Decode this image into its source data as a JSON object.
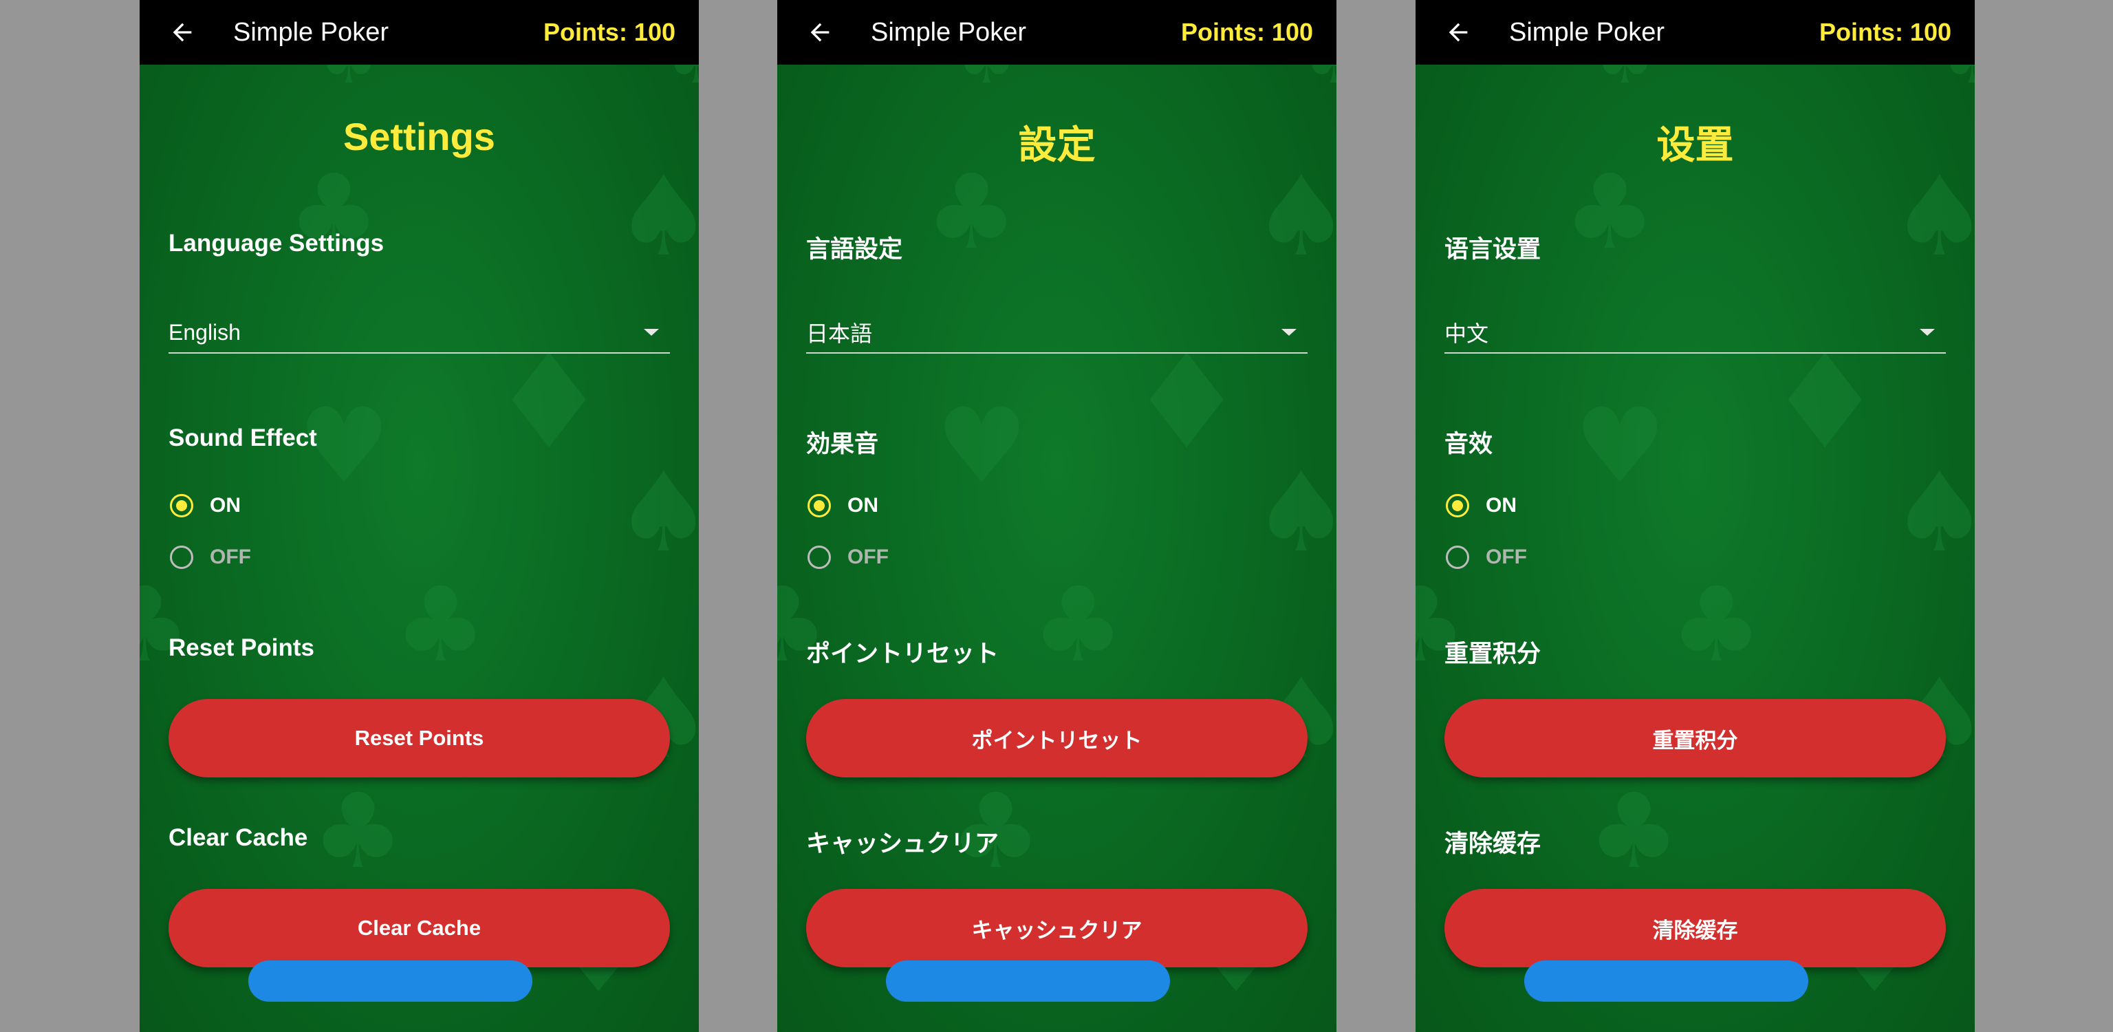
{
  "colors": {
    "background": "#969696",
    "felt": "#0a6a22",
    "accent": "#ffeb3b",
    "appbar": "#000000",
    "danger": "#d32f2f",
    "primary": "#1e88e5"
  },
  "icons": {
    "back": "arrow-left-icon",
    "dropdown": "caret-down-icon",
    "background_suits": [
      "spade",
      "club",
      "heart",
      "diamond"
    ]
  },
  "screens": [
    {
      "app_title": "Simple Poker",
      "points": "Points: 100",
      "title": "Settings",
      "language_label": "Language Settings",
      "language_value": "English",
      "sound_label": "Sound Effect",
      "sound_on": "ON",
      "sound_off": "OFF",
      "sound_selected": "ON",
      "reset_label": "Reset Points",
      "reset_button": "Reset Points",
      "cache_label": "Clear Cache",
      "cache_button": "Clear Cache"
    },
    {
      "app_title": "Simple Poker",
      "points": "Points: 100",
      "title": "設定",
      "language_label": "言語設定",
      "language_value": "日本語",
      "sound_label": "効果音",
      "sound_on": "ON",
      "sound_off": "OFF",
      "sound_selected": "ON",
      "reset_label": "ポイントリセット",
      "reset_button": "ポイントリセット",
      "cache_label": "キャッシュクリア",
      "cache_button": "キャッシュクリア"
    },
    {
      "app_title": "Simple Poker",
      "points": "Points: 100",
      "title": "设置",
      "language_label": "语言设置",
      "language_value": "中文",
      "sound_label": "音效",
      "sound_on": "ON",
      "sound_off": "OFF",
      "sound_selected": "ON",
      "reset_label": "重置积分",
      "reset_button": "重置积分",
      "cache_label": "清除缓存",
      "cache_button": "清除缓存"
    }
  ]
}
